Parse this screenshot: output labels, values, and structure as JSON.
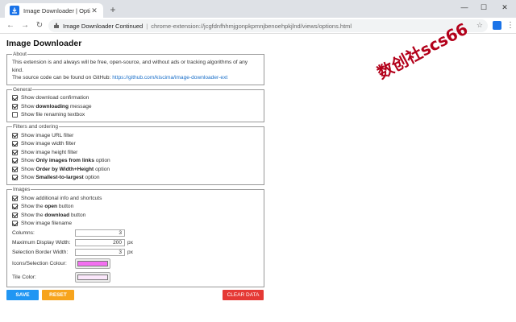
{
  "browser": {
    "tab_title": "Image Downloader | Options",
    "tab_close": "✕",
    "new_tab": "+",
    "window_controls": [
      "—",
      "☐",
      "✕"
    ],
    "nav": {
      "back": "←",
      "forward": "→",
      "reload": "↻"
    },
    "address_site": "Image Downloader Continued",
    "address_sep": "|",
    "address_url": "chrome-extension://jcgfdnfhhmjgonpkpmnjbenoehpkjlnd/views/options.html",
    "menu": "⋮"
  },
  "page": {
    "title": "Image Downloader",
    "about": {
      "legend": "About",
      "line1": "This extension is and always will be free, open-source, and without ads or tracking algorithms of any kind.",
      "line2_prefix": "The source code can be found on GitHub: ",
      "line2_link": "https://github.com/kiscima/image-downloader-ext"
    },
    "general": {
      "legend": "General",
      "options": [
        {
          "pre": "Show download confirmation",
          "bold": "",
          "post": "",
          "checked": true
        },
        {
          "pre": "Show ",
          "bold": "downloading",
          "post": " message",
          "checked": true
        },
        {
          "pre": "Show file renaming textbox",
          "bold": "",
          "post": "",
          "checked": false
        }
      ]
    },
    "filters": {
      "legend": "Filters and ordering",
      "options": [
        {
          "pre": "Show image URL filter",
          "bold": "",
          "post": "",
          "checked": true
        },
        {
          "pre": "Show image width filter",
          "bold": "",
          "post": "",
          "checked": true
        },
        {
          "pre": "Show image height filter",
          "bold": "",
          "post": "",
          "checked": true
        },
        {
          "pre": "Show ",
          "bold": "Only images from links",
          "post": " option",
          "checked": true
        },
        {
          "pre": "Show ",
          "bold": "Order by Width+Height",
          "post": " option",
          "checked": true
        },
        {
          "pre": "Show ",
          "bold": "Smallest-to-largest",
          "post": " option",
          "checked": true
        }
      ]
    },
    "images": {
      "legend": "Images",
      "options": [
        {
          "pre": "Show additional info and shortcuts",
          "bold": "",
          "post": "",
          "checked": true
        },
        {
          "pre": "Show the ",
          "bold": "open",
          "post": " button",
          "checked": true
        },
        {
          "pre": "Show the ",
          "bold": "download",
          "post": " button",
          "checked": true
        },
        {
          "pre": "Show image filename",
          "bold": "",
          "post": "",
          "checked": true
        }
      ],
      "columns_label": "Columns:",
      "columns_value": "3",
      "max_width_label": "Maximum Display Width:",
      "max_width_value": "200",
      "max_width_unit": "px",
      "border_label": "Selection Border Width:",
      "border_value": "3",
      "border_unit": "px",
      "icons_colour_label": "Icons/Selection Colour:",
      "icons_colour": "#f36ff0",
      "tile_colour_label": "Tile Color:",
      "tile_colour": "#fbe7fb"
    },
    "buttons": {
      "save": "SAVE",
      "reset": "RESET",
      "clear": "CLEAR DATA"
    }
  },
  "watermark": "数创社scs66",
  "colors": {
    "save": "#2196f3",
    "reset": "#f7a41d",
    "clear": "#e53935",
    "link": "#1a6fc9"
  }
}
